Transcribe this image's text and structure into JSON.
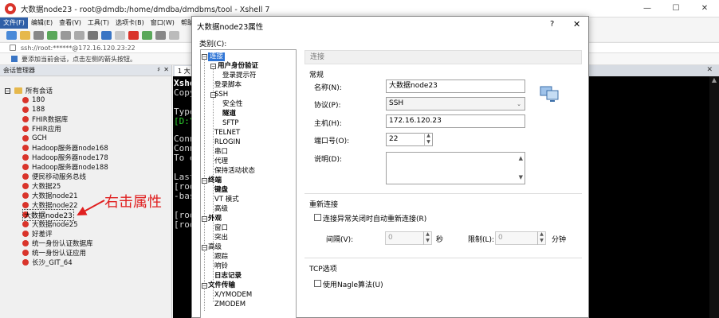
{
  "window": {
    "title": "大数据node23 - root@dmdb:/home/dmdba/dmdbms/tool - Xshell 7",
    "minimize": "—",
    "maximize": "☐",
    "close": "✕"
  },
  "menu": [
    "文件(F)",
    "编辑(E)",
    "查看(V)",
    "工具(T)",
    "选项卡(B)",
    "窗口(W)",
    "帮助(H)"
  ],
  "address": "ssh://root:******@172.16.120.23:22",
  "hint": "要添加当前会话，点击左侧的箭头按钮。",
  "session_manager": {
    "title": "会话管理器",
    "pin": "♯",
    "close": "✕",
    "root_label": "所有会话",
    "items": [
      "180",
      "188",
      "FHIR数据库",
      "FHIR应用",
      "GCH",
      "Hadoop服务器node168",
      "Hadoop服务器node178",
      "Hadoop服务器node188",
      "便民移动服务总线",
      "大数据25",
      "大数据node21",
      "大数据node22",
      "大数据node23",
      "大数据node25",
      "好差评",
      "统一身份认证数据库",
      "统一身份认证应用",
      "长沙_GIT_64"
    ]
  },
  "annotation": "右击属性",
  "terminal": {
    "tab": "1 大",
    "close": "✕",
    "lines": [
      "Xshe",
      "Copy",
      "",
      "Type",
      "[D:\\",
      "",
      "Conn",
      "Conn",
      "To e",
      "",
      "Last",
      "[roo",
      "-bas",
      "[roo",
      "[roo"
    ]
  },
  "dialog": {
    "title": "大数据node23属性",
    "help": "?",
    "close": "✕",
    "category_label": "类别(C):",
    "tree": {
      "connection": "连接",
      "user_auth": "用户身份验证",
      "login_prompt": "登录提示符",
      "login_script": "登录脚本",
      "ssh": "SSH",
      "security": "安全性",
      "tunnel": "隧道",
      "sftp": "SFTP",
      "telnet": "TELNET",
      "rlogin": "RLOGIN",
      "serial": "串口",
      "proxy": "代理",
      "keepalive": "保持活动状态",
      "terminal": "终端",
      "keyboard": "键盘",
      "vt_mode": "VT 模式",
      "advanced1": "高级",
      "appearance": "外观",
      "window": "窗口",
      "highlight": "突出",
      "advanced2": "高级",
      "trace": "跟踪",
      "bell": "响铃",
      "logging": "日志记录",
      "file_transfer": "文件传输",
      "xymodem": "X/YMODEM",
      "zmodem": "ZMODEM"
    },
    "section_header": "连接",
    "general": "常规",
    "name_label": "名称(N):",
    "name_value": "大数据node23",
    "protocol_label": "协议(P):",
    "protocol_value": "SSH",
    "host_label": "主机(H):",
    "host_value": "172.16.120.23",
    "port_label": "端口号(O):",
    "port_value": "22",
    "desc_label": "说明(D):",
    "reconnect": "重新连接",
    "reconnect_check": "连接异常关闭时自动重新连接(R)",
    "interval_label": "间隔(V):",
    "interval_value": "0",
    "seconds": "秒",
    "limit_label": "限制(L):",
    "limit_value": "0",
    "minutes": "分钟",
    "tcp": "TCP选项",
    "nagle": "使用Nagle算法(U)"
  },
  "colors": {
    "selection": "#2f75d6",
    "annotation": "#e02020",
    "terminal_bg": "#000000"
  }
}
